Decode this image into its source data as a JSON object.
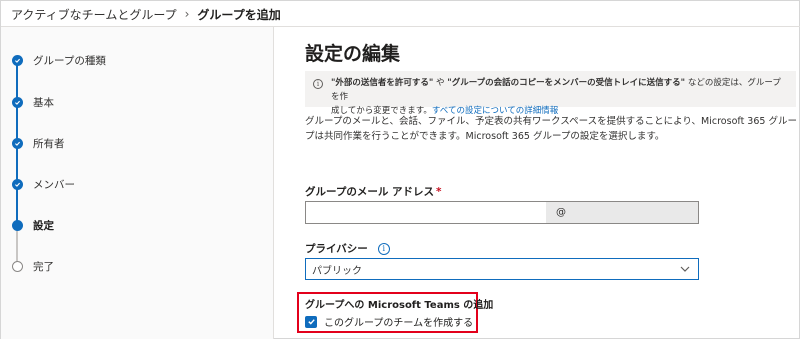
{
  "breadcrumb": {
    "parent": "アクティブなチームとグループ",
    "separator": "›",
    "current": "グループを追加"
  },
  "steps": [
    {
      "label": "グループの種類",
      "state": "done"
    },
    {
      "label": "基本",
      "state": "done"
    },
    {
      "label": "所有者",
      "state": "done"
    },
    {
      "label": "メンバー",
      "state": "done"
    },
    {
      "label": "設定",
      "state": "current"
    },
    {
      "label": "完了",
      "state": "pending"
    }
  ],
  "main": {
    "title": "設定の編集",
    "info": {
      "icon": "info-icon",
      "part1": "\"外部の送信者を許可する\"",
      "part2": " や ",
      "part3": "\"グループの会話のコピーをメンバーの受信トレイに送信する\"",
      "part4": " などの設定は、グループを作",
      "line2": "成してから変更できます。",
      "link": "すべての設定についての詳細情報"
    },
    "description": "グループのメールと、会話、ファイル、予定表の共有ワークスペースを提供することにより、Microsoft 365 グループは共同作業を行うことができます。Microsoft 365 グループの設定を選択します。",
    "email": {
      "label": "グループのメール アドレス",
      "required_mark": "*",
      "value": "",
      "domain_prefix": "@"
    },
    "privacy": {
      "label": "プライバシー",
      "info_glyph": "i",
      "selected": "パブリック"
    },
    "teams": {
      "label": "グループへの Microsoft Teams の追加",
      "checkbox_label": "このグループのチームを作成する",
      "checked": true
    }
  },
  "colors": {
    "accent": "#0f6cbd",
    "highlight_border": "#e3001b"
  }
}
